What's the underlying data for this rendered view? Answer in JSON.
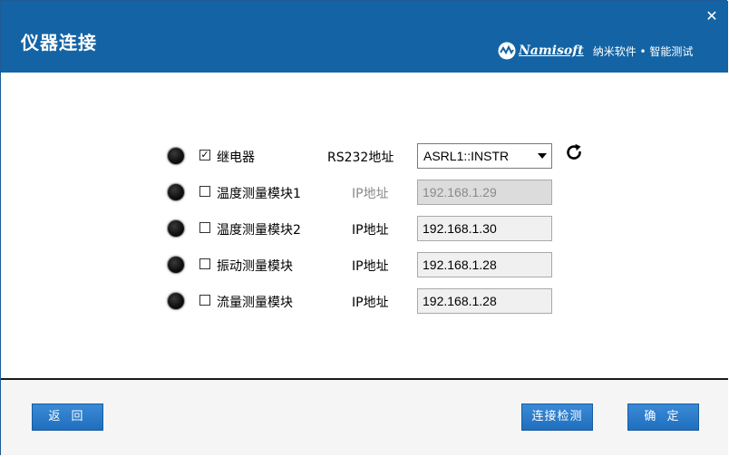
{
  "window": {
    "title": "仪器连接",
    "close_label": "✕",
    "brand": {
      "name": "Namisoft",
      "tagline": "纳米软件 • 智能测试"
    }
  },
  "rows": [
    {
      "checked": true,
      "device": "继电器",
      "addr_label": "RS232地址",
      "value": "ASRL1::INSTR",
      "type": "select"
    },
    {
      "checked": false,
      "device": "温度测量模块1",
      "addr_label": "IP地址",
      "value": "192.168.1.29",
      "type": "disabled"
    },
    {
      "checked": false,
      "device": "温度测量模块2",
      "addr_label": "IP地址",
      "value": "192.168.1.30",
      "type": "field"
    },
    {
      "checked": false,
      "device": "振动测量模块",
      "addr_label": "IP地址",
      "value": "192.168.1.28",
      "type": "field"
    },
    {
      "checked": false,
      "device": "流量测量模块",
      "addr_label": "IP地址",
      "value": "192.168.1.28",
      "type": "field"
    }
  ],
  "buttons": {
    "back": "返 回",
    "check": "连接检测",
    "ok": "确 定"
  },
  "icons": {
    "refresh": "refresh-icon",
    "close": "close-icon",
    "logo": "namisoft-logo-icon",
    "status": "status-led-icon"
  }
}
